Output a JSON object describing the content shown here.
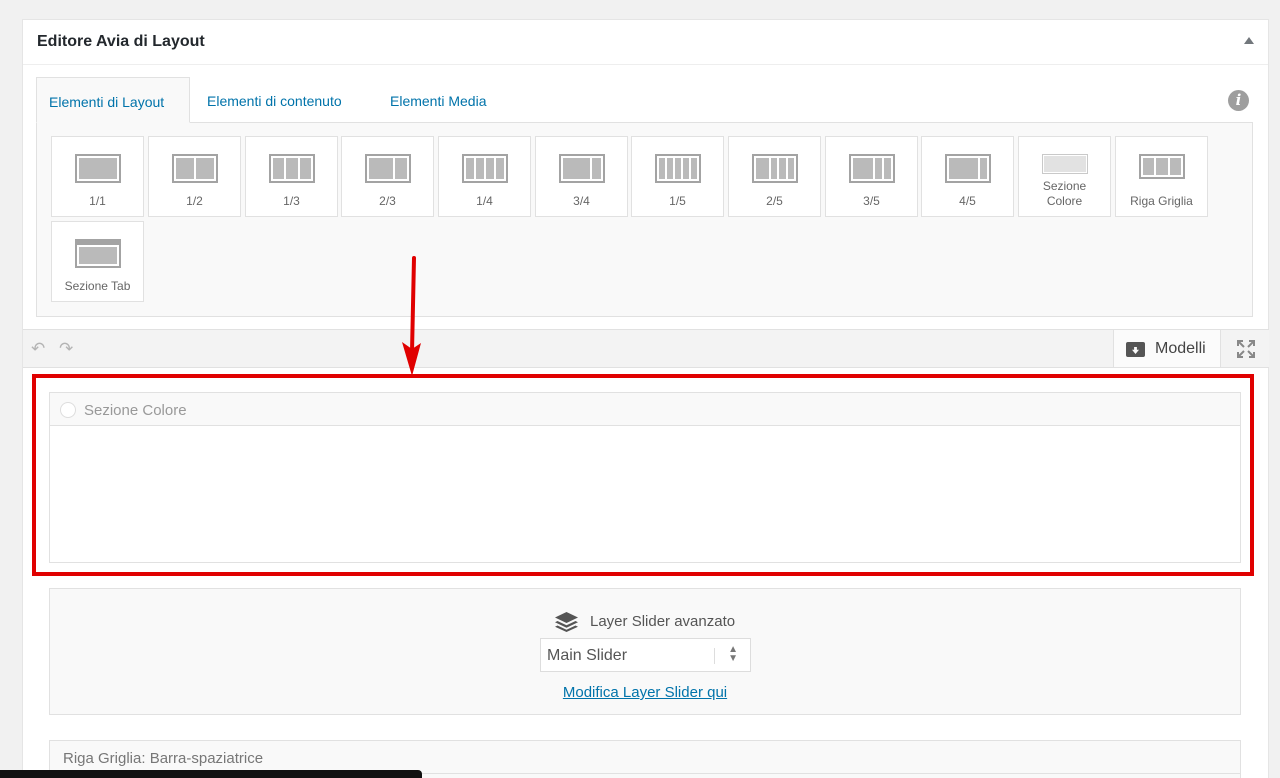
{
  "panel": {
    "title": "Editore Avia di Layout"
  },
  "tabs": [
    {
      "label": "Elementi di Layout"
    },
    {
      "label": "Elementi di contenuto"
    },
    {
      "label": "Elementi Media"
    }
  ],
  "elements": [
    {
      "label": "1/1",
      "icon": "layout-1-1-icon"
    },
    {
      "label": "1/2",
      "icon": "layout-1-2-icon"
    },
    {
      "label": "1/3",
      "icon": "layout-1-3-icon"
    },
    {
      "label": "2/3",
      "icon": "layout-2-3-icon"
    },
    {
      "label": "1/4",
      "icon": "layout-1-4-icon"
    },
    {
      "label": "3/4",
      "icon": "layout-3-4-icon"
    },
    {
      "label": "1/5",
      "icon": "layout-1-5-icon"
    },
    {
      "label": "2/5",
      "icon": "layout-2-5-icon"
    },
    {
      "label": "3/5",
      "icon": "layout-3-5-icon"
    },
    {
      "label": "4/5",
      "icon": "layout-4-5-icon"
    },
    {
      "label": "Sezione\nColore",
      "icon": "color-section-icon"
    },
    {
      "label": "Riga Griglia",
      "icon": "grid-row-icon"
    },
    {
      "label": "Sezione Tab",
      "icon": "tab-section-icon"
    }
  ],
  "toolbar": {
    "models_label": "Modelli"
  },
  "canvas": {
    "color_section_title": "Sezione Colore",
    "layer_slider": {
      "title": "Layer Slider avanzato",
      "selected": "Main Slider",
      "link": "Modifica Layer Slider qui"
    },
    "grid_row_title": "Riga Griglia: Barra-spaziatrice"
  },
  "colors": {
    "accent": "#0073aa",
    "highlight": "#e00000"
  }
}
